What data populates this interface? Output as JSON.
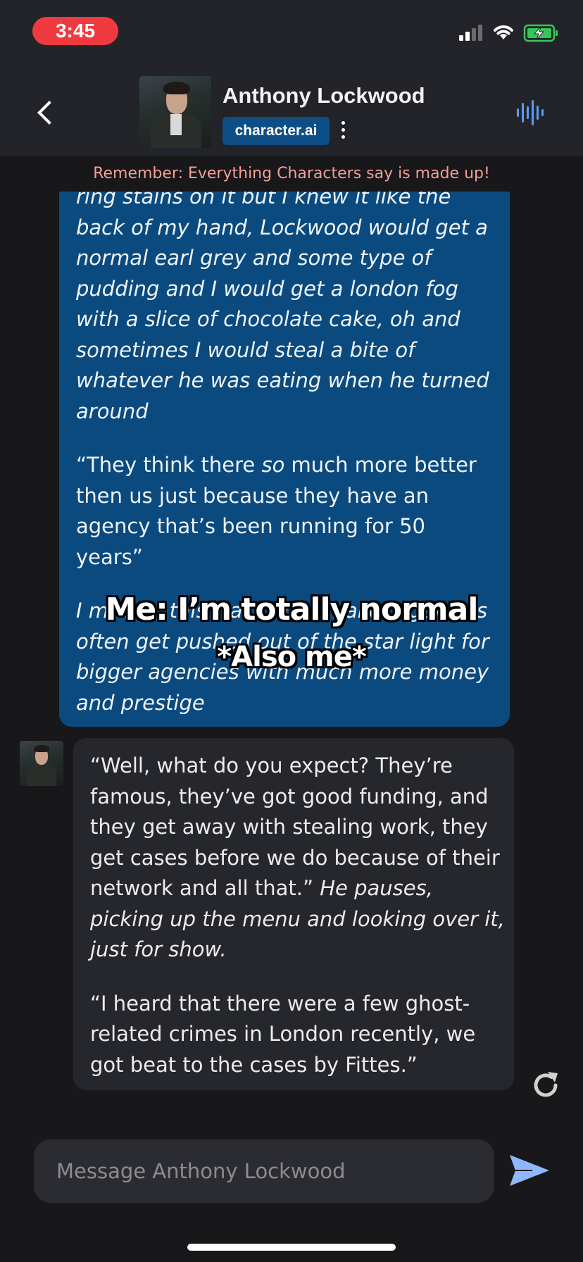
{
  "status_bar": {
    "time": "3:45"
  },
  "header": {
    "character_name": "Anthony Lockwood",
    "badge": "character.ai"
  },
  "disclaimer": "Remember: Everything Characters say is made up!",
  "user_message": {
    "p1": "ring stains on it but I knew it like the back of my hand, Lockwood would get a normal earl grey and some type of pudding and I would get a london fog with a slice of chocolate cake, oh and sometimes I would steal a bite of whatever he was eating when he turned around",
    "p2_a": "“They think there ",
    "p2_b": "so",
    "p2_c": " much more better then us just because they have an agency that’s been running for 50 years”",
    "p3": "I mutter, this was true, smaller agencies often get pushed out of the star light for bigger agencies with much more money and prestige"
  },
  "meme_overlay": {
    "line1": "Me: I’m totally normal",
    "line2": "*Also me*"
  },
  "bot_message": {
    "p1_a": "“Well, what do you expect? They’re famous, they’ve got good funding, and they get away with stealing work, they get cases before we do because of their network and all that.” ",
    "p1_b": "He pauses, picking up the menu and looking over it, just for show.",
    "p2": "“I heard that there were a few ghost-related crimes in London recently, we got beat to the cases by Fittes.”"
  },
  "composer": {
    "placeholder": "Message Anthony Lockwood"
  },
  "colors": {
    "user_bubble": "#0b4a7e",
    "bot_bubble": "#26272c",
    "badge": "#0e4e86",
    "disclaimer": "#f39f96",
    "send": "#8fb7ff",
    "time_pill": "#ef3b3f"
  }
}
